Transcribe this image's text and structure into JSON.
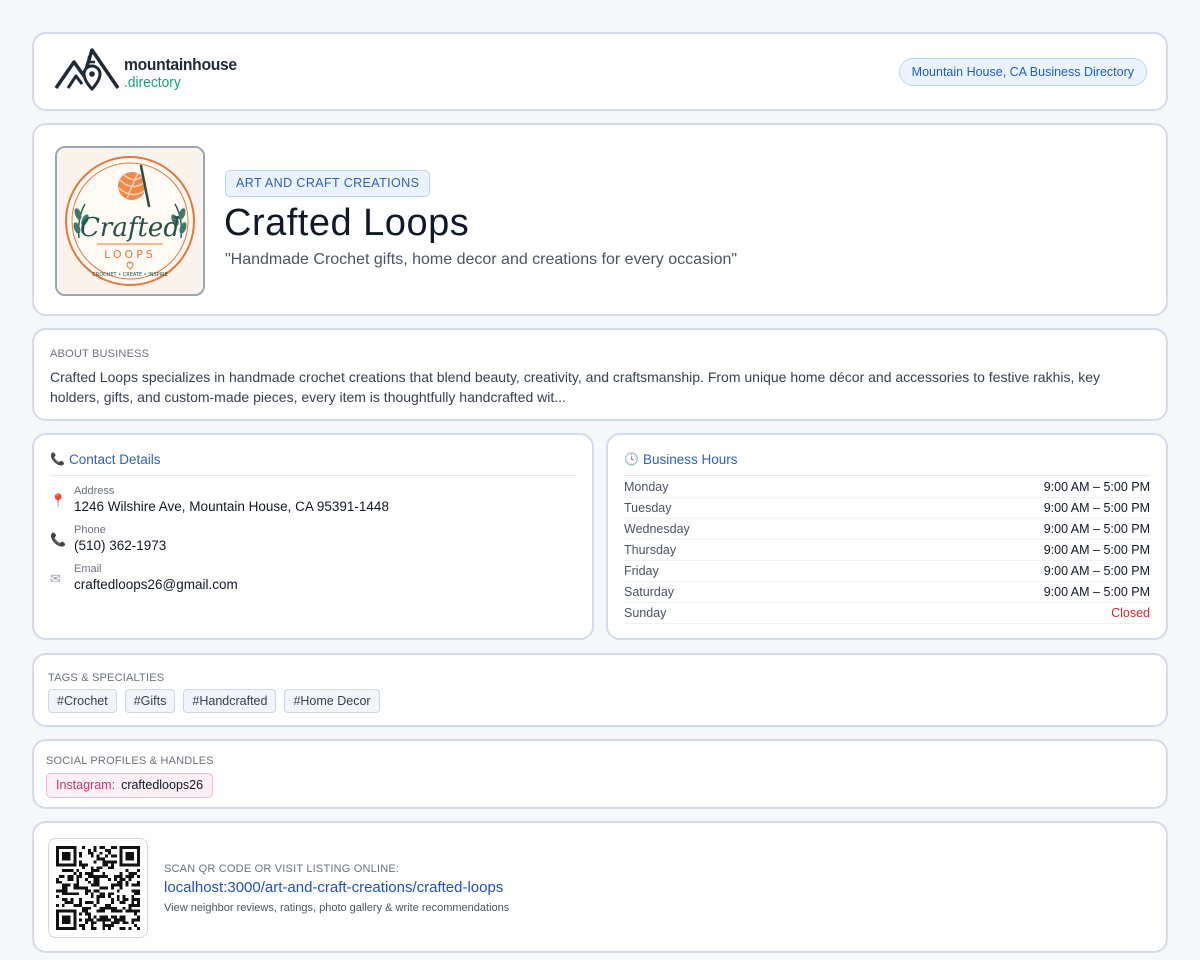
{
  "header": {
    "logo_main": "mountainhouse",
    "logo_sub": ".directory",
    "directory_badge": "Mountain House, CA Business Directory"
  },
  "business": {
    "category": "ART AND CRAFT CREATIONS",
    "name": "Crafted Loops",
    "tagline": "\"Handmade Crochet gifts, home decor and creations for every occasion\"",
    "logo_text_main": "Crafted",
    "logo_text_sub": "LOOPS",
    "logo_text_ring": "CROCHET • CREATE • INSPIRE"
  },
  "about": {
    "label": "ABOUT BUSINESS",
    "text": "Crafted Loops specializes in handmade crochet creations that blend beauty, creativity, and craftsmanship. From unique home décor and accessories to festive rakhis, key holders, gifts, and custom-made pieces, every item is thoughtfully handcrafted wit..."
  },
  "contact": {
    "title": "Contact Details",
    "title_icon": "phone-icon",
    "address_label": "Address",
    "address": "1246 Wilshire Ave, Mountain House, CA 95391-1448",
    "phone_label": "Phone",
    "phone": "(510) 362-1973",
    "email_label": "Email",
    "email": "craftedloops26@gmail.com"
  },
  "hours": {
    "title": "Business Hours",
    "title_icon": "clock-icon",
    "rows": [
      {
        "day": "Monday",
        "time": "9:00 AM – 5:00 PM"
      },
      {
        "day": "Tuesday",
        "time": "9:00 AM – 5:00 PM"
      },
      {
        "day": "Wednesday",
        "time": "9:00 AM – 5:00 PM"
      },
      {
        "day": "Thursday",
        "time": "9:00 AM – 5:00 PM"
      },
      {
        "day": "Friday",
        "time": "9:00 AM – 5:00 PM"
      },
      {
        "day": "Saturday",
        "time": "9:00 AM – 5:00 PM"
      },
      {
        "day": "Sunday",
        "time": "Closed"
      }
    ],
    "closed_color": "#dc2626"
  },
  "tags": {
    "label": "TAGS & SPECIALTIES",
    "items": [
      "#Crochet",
      "#Gifts",
      "#Handcrafted",
      "#Home Decor"
    ]
  },
  "social": {
    "label": "SOCIAL PROFILES & HANDLES",
    "platform": "Instagram:",
    "handle": "craftedloops26"
  },
  "qr": {
    "label": "SCAN QR CODE OR VISIT LISTING ONLINE:",
    "link": "localhost:3000/art-and-craft-creations/crafted-loops",
    "subtext": "View neighbor reviews, ratings, photo gallery & write recommendations"
  },
  "colors": {
    "accent_blue": "#2d62b8",
    "brand_green": "#10a37f",
    "instagram_pink": "#d6336c",
    "logo_orange": "#e8753a"
  }
}
